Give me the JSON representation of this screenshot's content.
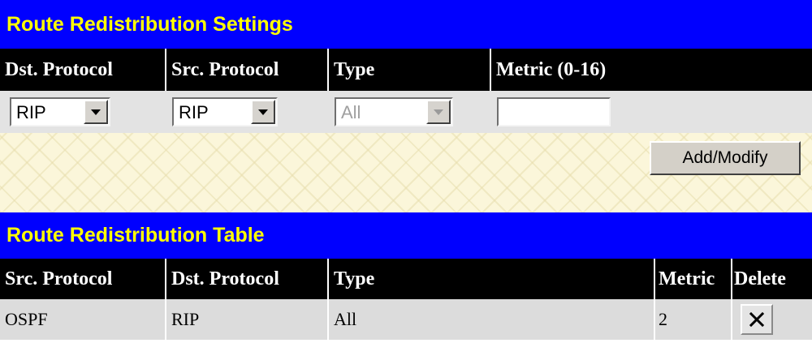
{
  "settings": {
    "title": "Route Redistribution Settings",
    "headers": [
      "Dst. Protocol",
      "Src. Protocol",
      "Type",
      "Metric (0-16)"
    ],
    "dst_protocol": "RIP",
    "src_protocol": "RIP",
    "type": "All",
    "metric": "",
    "add_modify_label": "Add/Modify"
  },
  "table": {
    "title": "Route Redistribution Table",
    "headers": [
      "Src. Protocol",
      "Dst. Protocol",
      "Type",
      "Metric",
      "Delete"
    ],
    "rows": [
      {
        "src": "OSPF",
        "dst": "RIP",
        "type": "All",
        "metric": "2",
        "delete_icon": "close-icon"
      }
    ]
  },
  "colors": {
    "header_bg": "#0000ff",
    "header_text": "#ffff00",
    "column_header_bg": "#000000",
    "column_header_text": "#ffffff"
  }
}
